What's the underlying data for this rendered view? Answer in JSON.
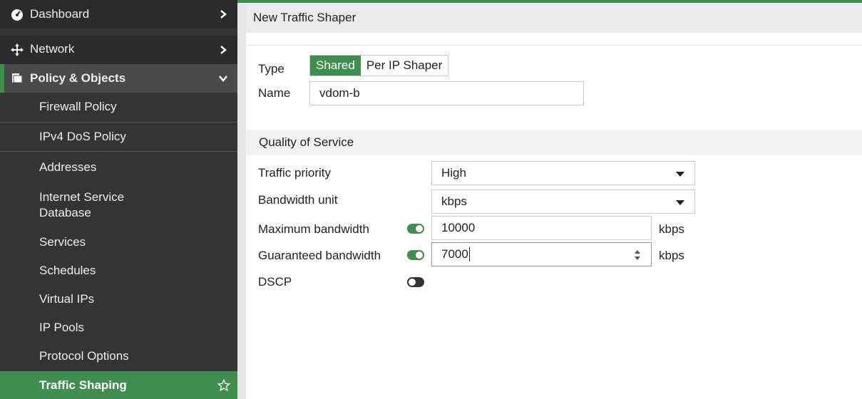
{
  "sidebar": {
    "items": [
      {
        "label": "Dashboard",
        "icon": "dashboard-icon"
      },
      {
        "label": "Network",
        "icon": "network-icon"
      },
      {
        "label": "Policy & Objects",
        "icon": "policy-icon"
      }
    ],
    "sub_items": [
      {
        "label": "Firewall Policy"
      },
      {
        "label": "IPv4 DoS Policy"
      },
      {
        "label": "Addresses"
      },
      {
        "label": "Internet Service Database"
      },
      {
        "label": "Services"
      },
      {
        "label": "Schedules"
      },
      {
        "label": "Virtual IPs"
      },
      {
        "label": "IP Pools"
      },
      {
        "label": "Protocol Options"
      },
      {
        "label": "Traffic Shaping"
      }
    ]
  },
  "header": {
    "title": "New Traffic Shaper"
  },
  "form": {
    "type_label": "Type",
    "type_options": [
      "Shared",
      "Per IP Shaper"
    ],
    "type_selected": "Shared",
    "name_label": "Name",
    "name_value": "vdom-b"
  },
  "qos": {
    "section_title": "Quality of Service",
    "traffic_priority_label": "Traffic priority",
    "traffic_priority_value": "High",
    "bandwidth_unit_label": "Bandwidth unit",
    "bandwidth_unit_value": "kbps",
    "max_bandwidth_label": "Maximum bandwidth",
    "max_bandwidth_value": "10000",
    "max_bandwidth_enabled": true,
    "guaranteed_bandwidth_label": "Guaranteed bandwidth",
    "guaranteed_bandwidth_value": "7000",
    "guaranteed_bandwidth_enabled": true,
    "unit_text": "kbps",
    "dscp_label": "DSCP",
    "dscp_enabled": false
  },
  "colors": {
    "accent": "#3f8d4f",
    "sidebar_bg": "#343434"
  }
}
